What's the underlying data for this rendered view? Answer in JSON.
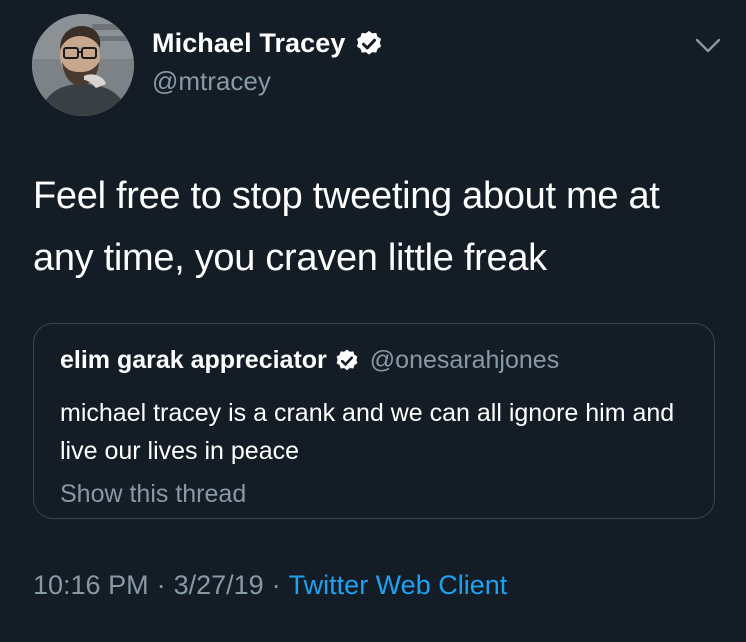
{
  "tweet": {
    "author_name": "Michael Tracey",
    "author_handle": "@mtracey",
    "verified": true,
    "text": "Feel free to stop tweeting about me at any time, you craven little freak",
    "quoted": {
      "author_name": "elim garak appreciator",
      "author_handle": "@onesarahjones",
      "verified": true,
      "text": "michael tracey is a crank and we can all ignore him and live our lives in peace",
      "show_thread_label": "Show this thread"
    },
    "time": "10:16 PM",
    "date": "3/27/19",
    "separator": "·",
    "client": "Twitter Web Client"
  },
  "icons": {
    "verified": "verified-badge-icon",
    "menu": "chevron-down-icon"
  },
  "colors": {
    "background": "#141d26",
    "primary_text": "#ffffff",
    "secondary_text": "#8899a6",
    "link": "#1da1f2",
    "border": "#38444d"
  }
}
